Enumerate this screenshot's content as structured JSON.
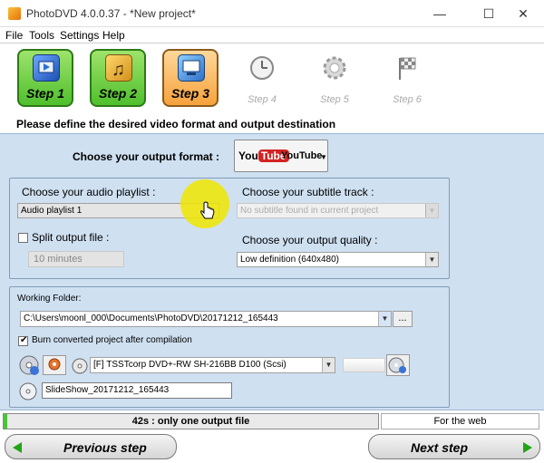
{
  "window": {
    "title": "PhotoDVD 4.0.0.37 - *New project*"
  },
  "menu": {
    "file": "File",
    "tools": "Tools",
    "settings": "Settings",
    "help": "Help"
  },
  "steps": [
    {
      "label": "Step 1",
      "state": "done",
      "icon": "video-icon"
    },
    {
      "label": "Step 2",
      "state": "done",
      "icon": "music-icon"
    },
    {
      "label": "Step 3",
      "state": "current",
      "icon": "output-icon"
    },
    {
      "label": "Step 4",
      "state": "disabled",
      "icon": "clock-icon"
    },
    {
      "label": "Step 5",
      "state": "disabled",
      "icon": "gear-icon"
    },
    {
      "label": "Step 6",
      "state": "disabled",
      "icon": "checkered-flag-icon"
    }
  ],
  "prompt": "Please define the desired video format and output destination",
  "format": {
    "label": "Choose your output format :",
    "yt_you": "You",
    "yt_tube": "Tube",
    "selected": "YouTube"
  },
  "audio": {
    "label": "Choose your audio playlist :",
    "value": "Audio playlist 1"
  },
  "subtitle": {
    "label": "Choose your subtitle track :",
    "value": "No subtitle found in current project"
  },
  "split": {
    "label": "Split output file :",
    "value": "10 minutes",
    "checked": false
  },
  "quality": {
    "label": "Choose your output quality :",
    "value": "Low definition (640x480)"
  },
  "working": {
    "label": "Working Folder:",
    "path": "C:\\Users\\moonl_000\\Documents\\PhotoDVD\\20171212_165443",
    "browse": "..."
  },
  "burn": {
    "label": "Burn converted project after compilation",
    "checked": true
  },
  "drive": {
    "value": "[F] TSSTcorp DVD+-RW SH-216BB D100 (Scsi)"
  },
  "disc_label": {
    "value": "SlideShow_20171212_165443"
  },
  "status": {
    "text": "42s : only one output file",
    "right": "For the web",
    "progress": 0.01
  },
  "nav": {
    "previous": "Previous step",
    "next": "Next step"
  },
  "colors": {
    "panel": "#cfe0f1",
    "step_done": "#4fbf2d",
    "step_current": "#f6a23c",
    "progress": "#4cc43a",
    "arrow": "#22a416"
  }
}
